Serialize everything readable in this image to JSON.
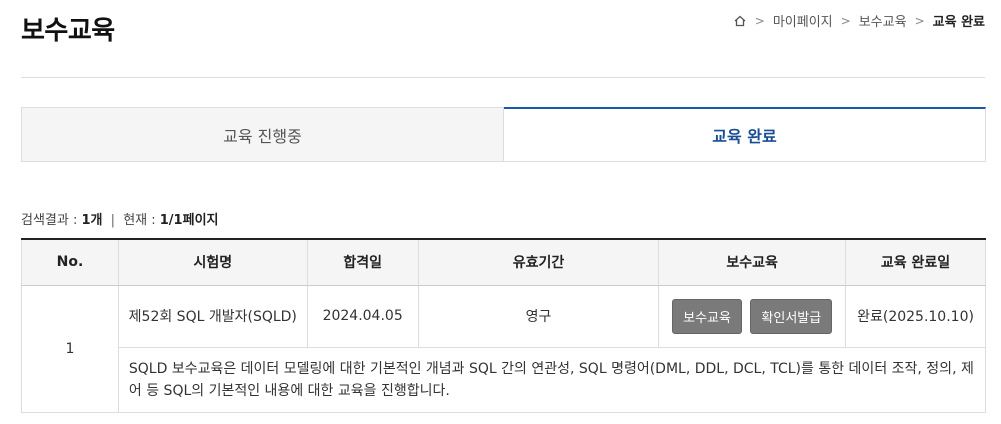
{
  "page": {
    "title": "보수교육"
  },
  "breadcrumb": {
    "home_icon": "home-icon",
    "sep": ">",
    "items": [
      "마이페이지",
      "보수교육",
      "교육 완료"
    ]
  },
  "tabs": [
    {
      "label": "교육 진행중",
      "active": false
    },
    {
      "label": "교육 완료",
      "active": true
    }
  ],
  "search_info": {
    "result_label": "검색결과 :",
    "result_count": "1개",
    "divider": "|",
    "current_label": "현재 :",
    "current_page": "1/1페이지"
  },
  "table": {
    "headers": [
      "No.",
      "시험명",
      "합격일",
      "유효기간",
      "보수교육",
      "교육 완료일"
    ],
    "rows": [
      {
        "no": "1",
        "exam_name": "제52회 SQL 개발자(SQLD)",
        "pass_date": "2024.04.05",
        "validity": "영구",
        "buttons": [
          "보수교육",
          "확인서발급"
        ],
        "completion": "완료(2025.10.10)",
        "description": "SQLD 보수교육은 데이터 모델링에 대한 기본적인 개념과 SQL 간의 연관성, SQL 명령어(DML, DDL, DCL, TCL)를 통한 데이터 조작, 정의, 제어 등 SQL의 기본적인 내용에 대한 교육을 진행합니다."
      }
    ]
  },
  "colors": {
    "accent": "#1a5aa8",
    "button_bg": "#7a7a7a"
  }
}
